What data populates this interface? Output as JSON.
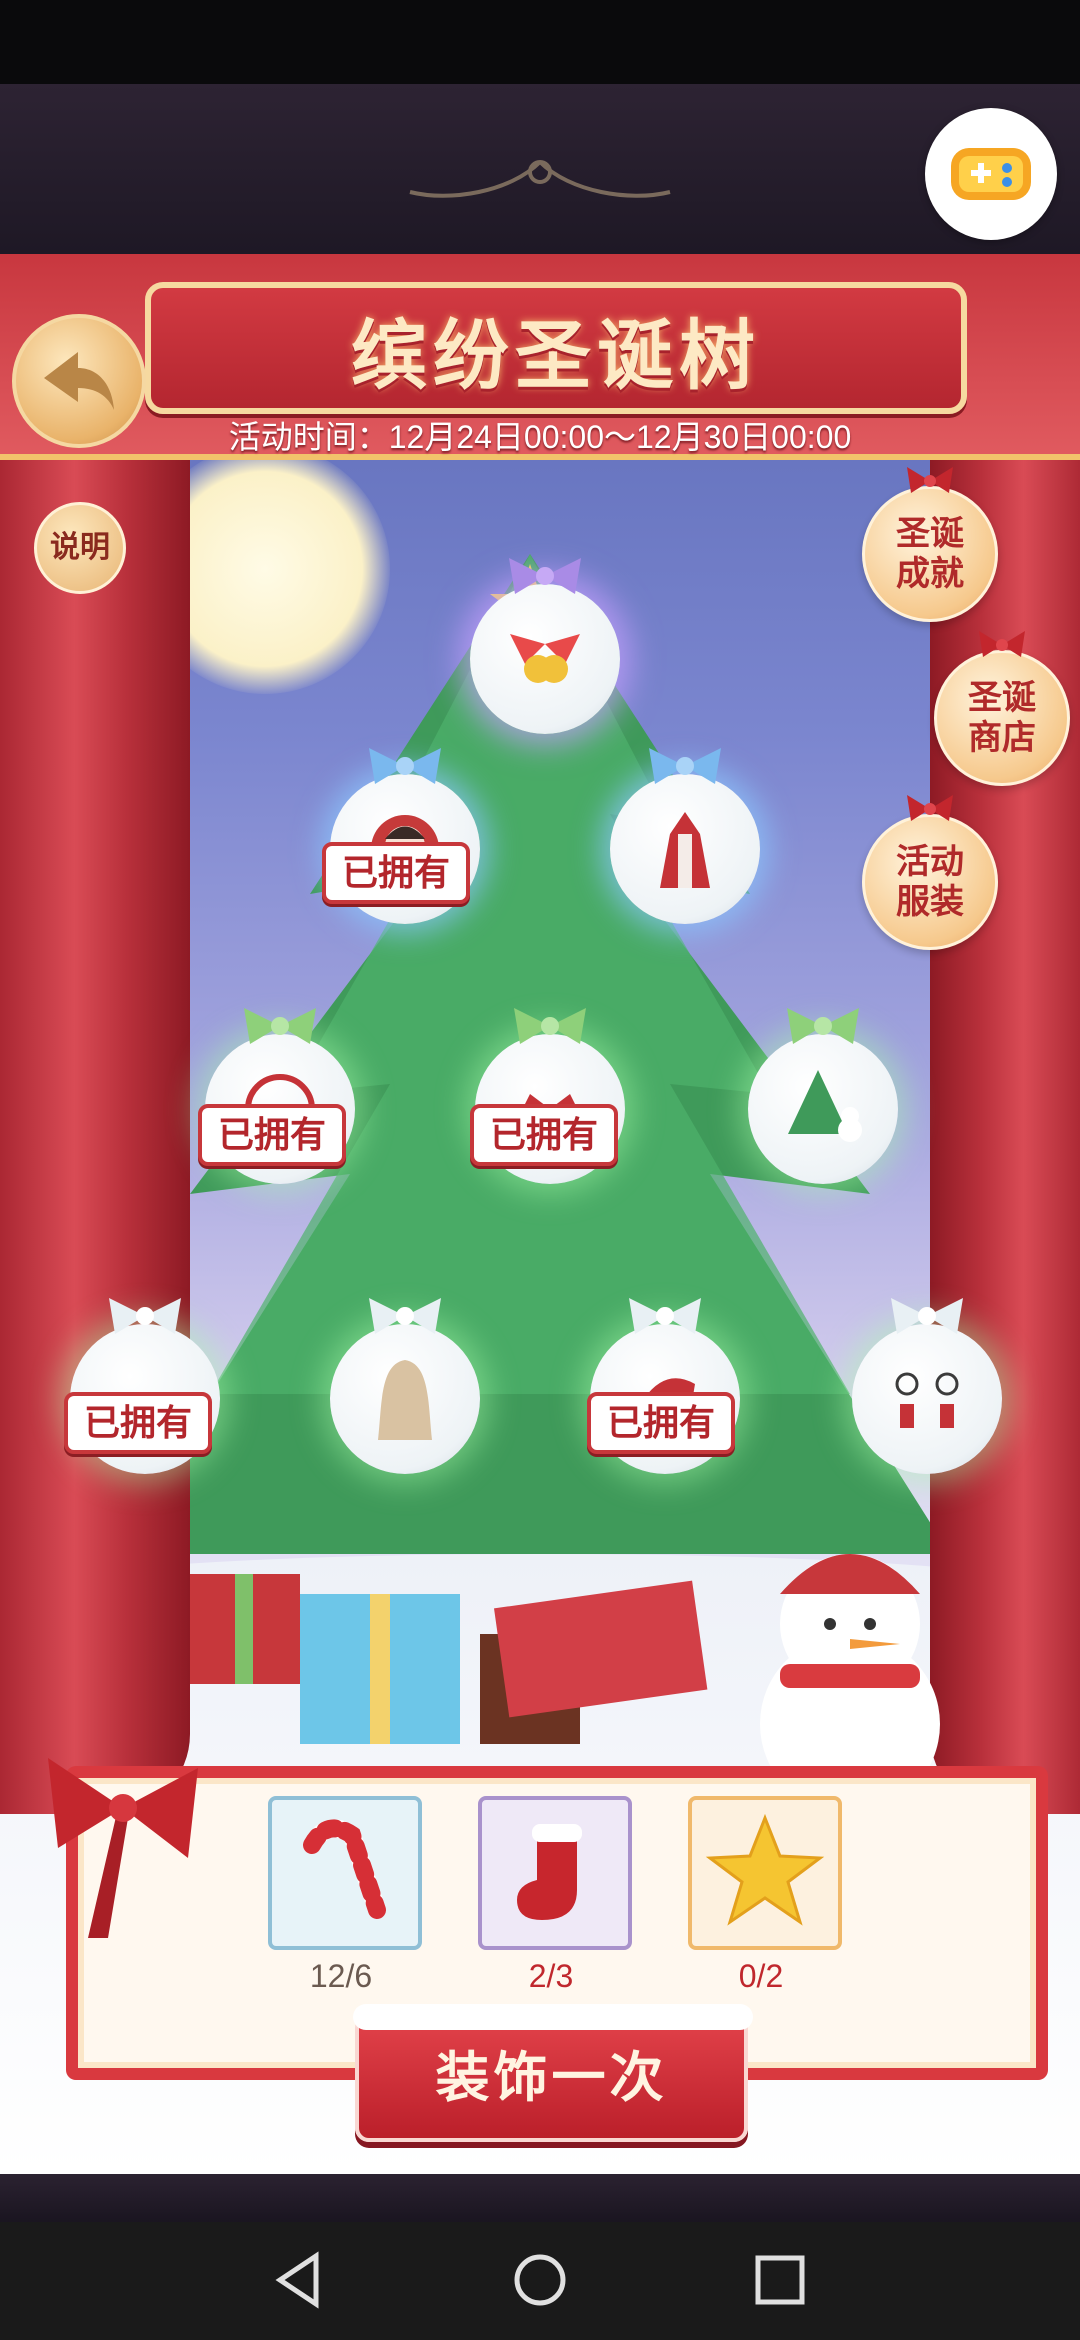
{
  "banner": {
    "title": "缤纷圣诞树",
    "event_time": "活动时间：12月24日00:00～12月30日00:00"
  },
  "left_buttons": {
    "help_label": "说明"
  },
  "side_buttons": [
    {
      "label": "圣诞成就"
    },
    {
      "label": "圣诞商店"
    },
    {
      "label": "活动服装"
    }
  ],
  "owned_label": "已拥有",
  "ornaments": [
    {
      "name": "wings-bells",
      "owned": false
    },
    {
      "name": "girl-portrait",
      "owned": true
    },
    {
      "name": "red-dress",
      "owned": false
    },
    {
      "name": "reindeer-wreath",
      "owned": true
    },
    {
      "name": "crown-item",
      "owned": true
    },
    {
      "name": "mini-tree",
      "owned": false
    },
    {
      "name": "pale-item",
      "owned": true
    },
    {
      "name": "long-hair",
      "owned": false
    },
    {
      "name": "santa-hat",
      "owned": true
    },
    {
      "name": "earrings",
      "owned": false
    }
  ],
  "materials": [
    {
      "icon": "candy-cane-icon",
      "count": "12/6"
    },
    {
      "icon": "stocking-icon",
      "count": "2/3"
    },
    {
      "icon": "star-icon",
      "count": "0/2"
    }
  ],
  "decorate_button": "装饰一次",
  "colors": {
    "accent": "#c7373b",
    "banner_text": "#fde9c4"
  }
}
